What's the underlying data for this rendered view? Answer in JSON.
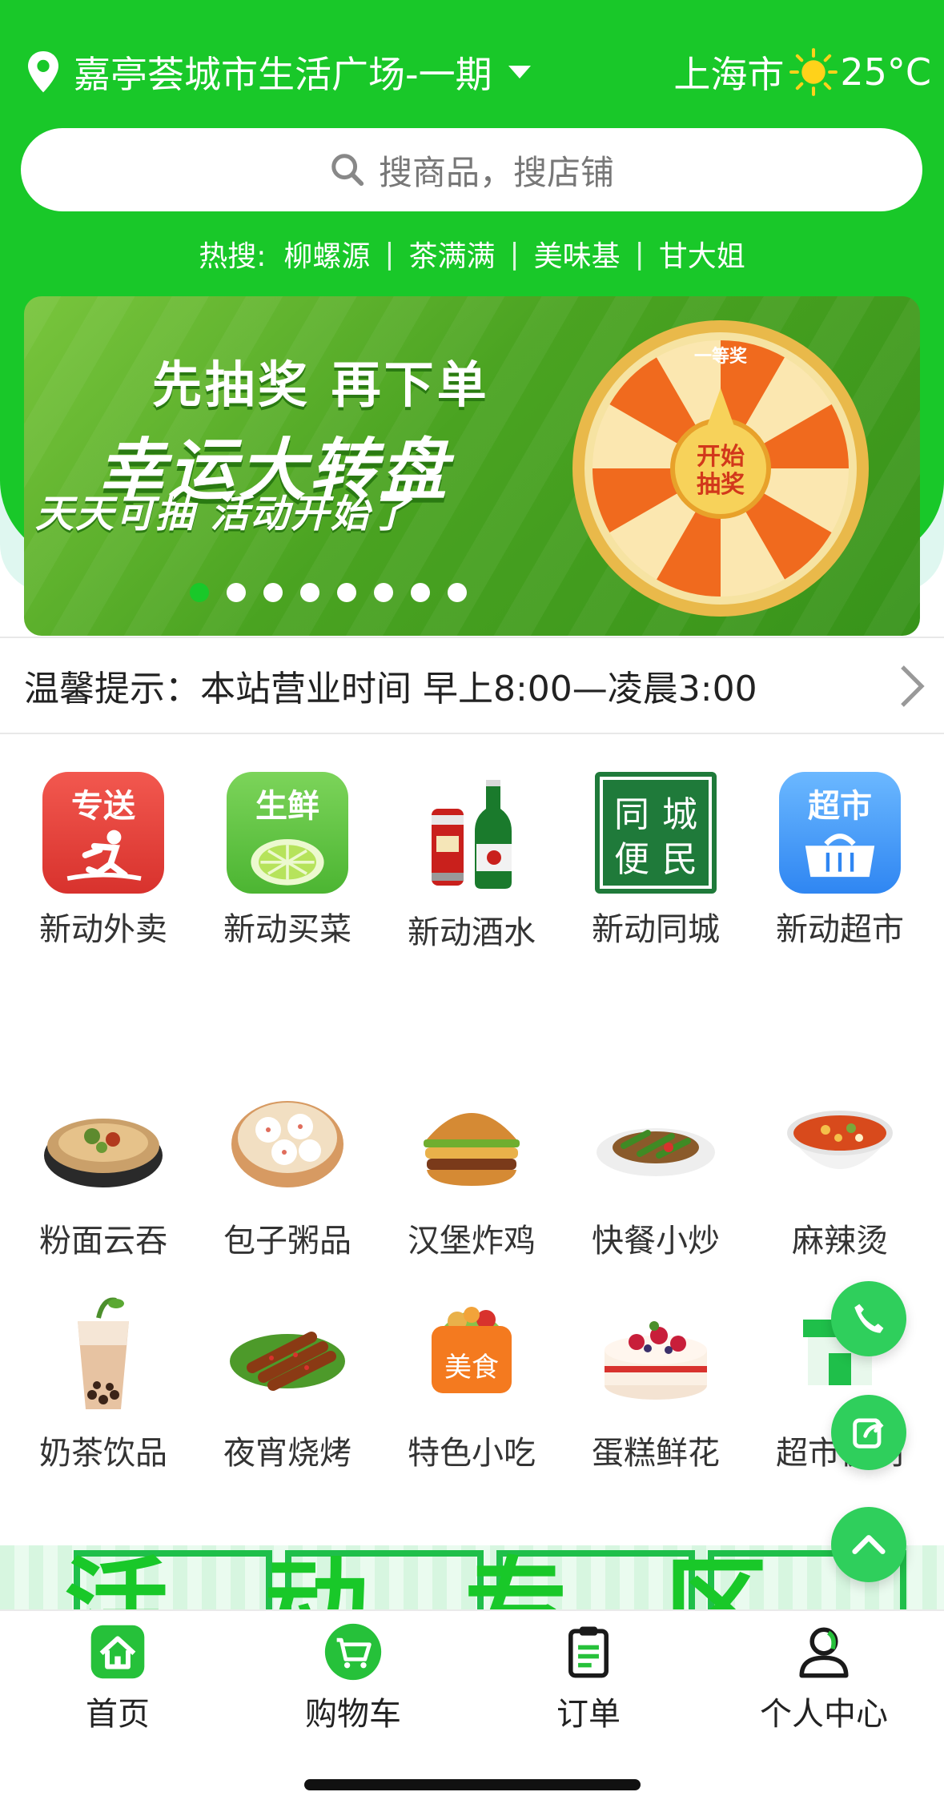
{
  "header": {
    "location": "嘉亭荟城市生活广场-一期",
    "city": "上海市",
    "temperature": "25°C",
    "search_placeholder": "搜商品，搜店铺",
    "hot_label": "热搜:",
    "hot_terms": [
      "柳螺源",
      "茶满满",
      "美味基",
      "甘大姐"
    ],
    "brand_color": "#19c829"
  },
  "banner": {
    "line1": "先抽奖 再下单",
    "line2": "幸运大转盘",
    "line3": "天天可抽 活动开始了",
    "wheel_center": [
      "开始",
      "抽奖"
    ],
    "wheel_top": "一等奖",
    "slide_count": 8,
    "active_slide": 0
  },
  "notice": {
    "text": "温馨提示：本站营业时间 早上8:00—凌晨3:00"
  },
  "categories_top": [
    {
      "label": "新动外卖",
      "icon": "delivery-icon",
      "badge": "专送"
    },
    {
      "label": "新动买菜",
      "icon": "fresh-food-icon",
      "badge": "生鲜"
    },
    {
      "label": "新动酒水",
      "icon": "beer-icon"
    },
    {
      "label": "新动同城",
      "icon": "local-convenience-icon",
      "badge": "同城便民"
    },
    {
      "label": "新动超市",
      "icon": "supermarket-icon",
      "badge": "超市"
    }
  ],
  "categories_food_row1": [
    {
      "label": "粉面云吞",
      "icon": "noodles-icon"
    },
    {
      "label": "包子粥品",
      "icon": "dumplings-icon"
    },
    {
      "label": "汉堡炸鸡",
      "icon": "burger-icon"
    },
    {
      "label": "快餐小炒",
      "icon": "stir-fry-icon"
    },
    {
      "label": "麻辣烫",
      "icon": "spicy-soup-icon"
    }
  ],
  "categories_food_row2": [
    {
      "label": "奶茶饮品",
      "icon": "milk-tea-icon"
    },
    {
      "label": "夜宵烧烤",
      "icon": "bbq-icon"
    },
    {
      "label": "特色小吃",
      "icon": "snack-icon",
      "badge": "美食"
    },
    {
      "label": "蛋糕鲜花",
      "icon": "cake-icon"
    },
    {
      "label": "超市便利",
      "icon": "store-icon"
    }
  ],
  "activity": {
    "title": "活动专区"
  },
  "tabbar": [
    {
      "label": "首页",
      "icon": "home-icon",
      "active": true
    },
    {
      "label": "购物车",
      "icon": "cart-icon"
    },
    {
      "label": "订单",
      "icon": "order-icon"
    },
    {
      "label": "个人中心",
      "icon": "user-icon"
    }
  ]
}
